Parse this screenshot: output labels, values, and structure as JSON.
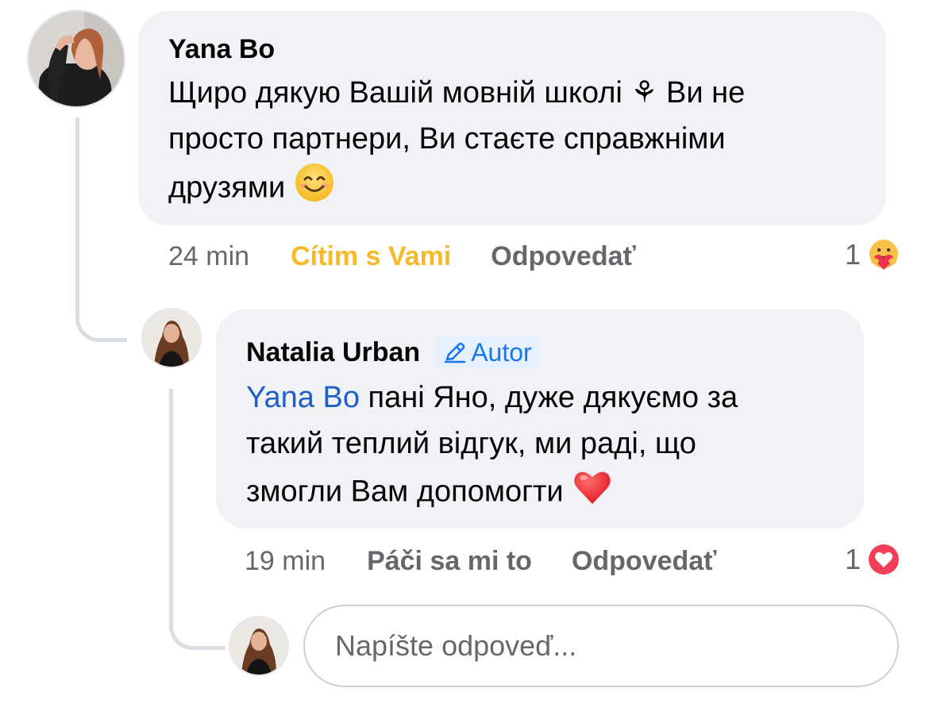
{
  "comment": {
    "author": "Yana Bo",
    "text_line1": "Щиро дякую Вашій мовній школі ⚘ Ви не",
    "text_line2": "просто партнери, Ви стаєте справжніми",
    "text_line3": "друзями",
    "trailing_emoji": "smiling-face-icon",
    "time": "24 min",
    "reaction_label": "Cítim s Vami",
    "reply_label": "Odpovedať",
    "reaction_count": "1",
    "reaction_icon": "care-reaction-icon",
    "reaction_color": "#f7b928"
  },
  "reply": {
    "author": "Natalia Urban",
    "badge_label": "Autor",
    "badge_color": "#1877f2",
    "mention": "Yana Bo",
    "text_line1": " пані Яно, дуже дякуємо за",
    "text_line2": "такий теплий відгук, ми раді, що",
    "text_line3": "змогли Вам допомогти",
    "trailing_emoji": "red-heart-icon",
    "time": "19 min",
    "reaction_label": "Páči sa mi to",
    "reply_label": "Odpovedať",
    "reaction_count": "1",
    "reaction_icon": "love-reaction-icon"
  },
  "composer": {
    "placeholder": "Napíšte odpoveď..."
  },
  "colors": {
    "bubble_bg": "#f0f2f5",
    "secondary_text": "#65676b",
    "mention": "#1f5fc6"
  }
}
